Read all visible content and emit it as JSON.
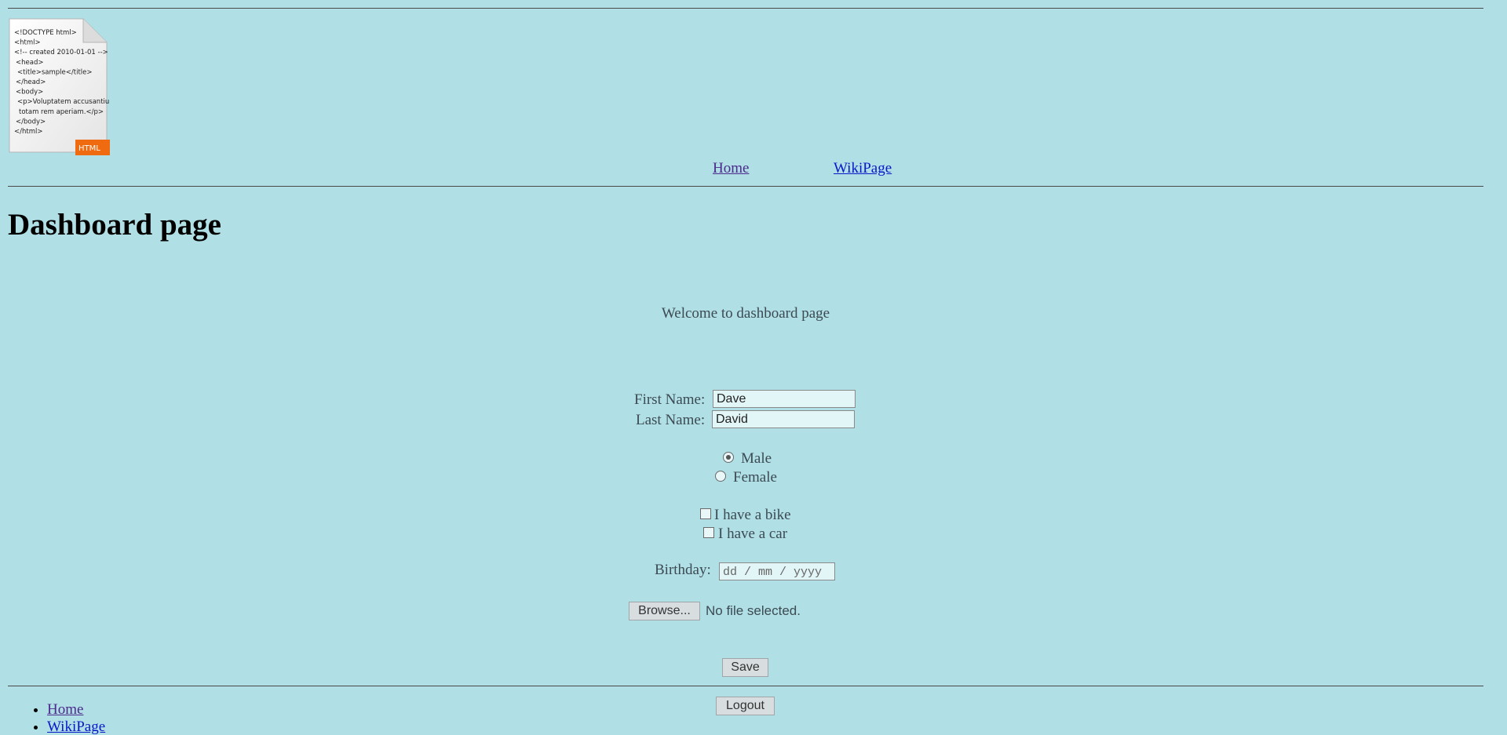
{
  "logo": {
    "lines": [
      "<!DOCTYPE html>",
      "<html>",
      "<!-- created 2010-01-01 -->",
      "<head>",
      "<title>sample</title>",
      "</head>",
      "<body>",
      "<p>Voluptatem accusantium",
      "totam rem aperiam.</p>",
      "</body>",
      "</html>"
    ],
    "badge": "HTML"
  },
  "nav": {
    "home": "Home",
    "wiki": "WikiPage"
  },
  "page_title": "Dashboard page",
  "welcome": "Welcome to dashboard page",
  "form": {
    "first_name_label": "First Name:",
    "first_name_value": "Dave",
    "last_name_label": "Last Name:",
    "last_name_value": "David",
    "gender_options": [
      "Male",
      "Female"
    ],
    "gender_selected": "Male",
    "vehicles": [
      "I have a bike",
      "I have a car"
    ],
    "birthday_label": "Birthday:",
    "birthday_placeholder": "dd / mm / yyyy",
    "browse_label": "Browse...",
    "file_status": "No file selected.",
    "save_label": "Save"
  },
  "logout_label": "Logout",
  "footer": {
    "links": [
      "Home",
      "WikiPage"
    ]
  }
}
